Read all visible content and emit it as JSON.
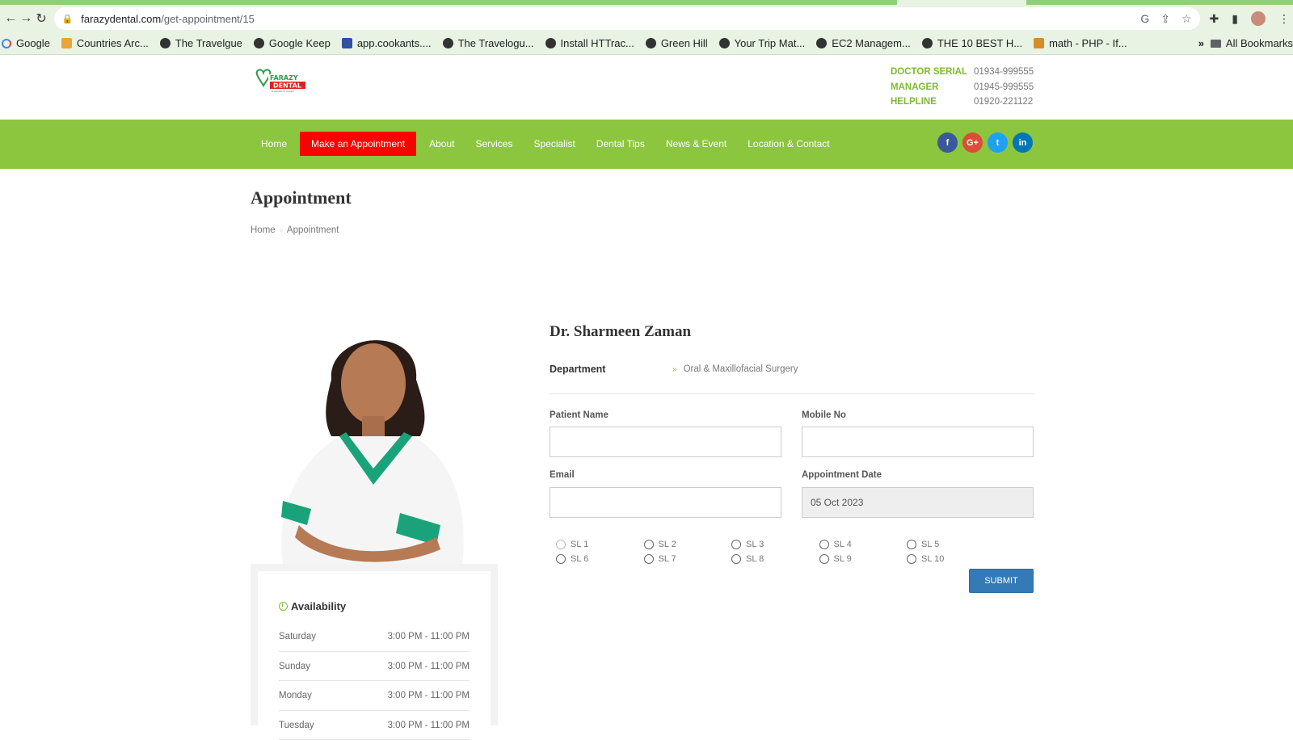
{
  "browser": {
    "url_domain": "farazydental.com",
    "url_path": "/get-appointment/15",
    "bookmarks": [
      {
        "label": "Google",
        "icon": "google-icon"
      },
      {
        "label": "Countries Arc...",
        "icon": "page-icon"
      },
      {
        "label": "The Travelgue",
        "icon": "globe-icon"
      },
      {
        "label": "Google Keep",
        "icon": "globe-icon"
      },
      {
        "label": "app.cookants....",
        "icon": "cookants-icon"
      },
      {
        "label": "The Travelogu...",
        "icon": "globe-icon"
      },
      {
        "label": "Install HTTrac...",
        "icon": "globe-icon"
      },
      {
        "label": "Green Hill",
        "icon": "globe-icon"
      },
      {
        "label": "Your Trip Mat...",
        "icon": "globe-icon"
      },
      {
        "label": "EC2 Managem...",
        "icon": "globe-icon"
      },
      {
        "label": "THE 10 BEST H...",
        "icon": "globe-icon"
      },
      {
        "label": "math - PHP - If...",
        "icon": "stackoverflow-icon"
      }
    ],
    "more": "»",
    "all_bookmarks": "All Bookmarks"
  },
  "header": {
    "contacts": [
      {
        "label": "DOCTOR SERIAL",
        "value": "01934-999555"
      },
      {
        "label": "MANAGER",
        "value": "01945-999555"
      },
      {
        "label": "HELPLINE",
        "value": "01920-221122"
      }
    ]
  },
  "nav": {
    "items": [
      "Home",
      "Make an Appointment",
      "About",
      "Services",
      "Specialist",
      "Dental Tips",
      "News & Event",
      "Location & Contact"
    ],
    "active_index": 1,
    "social": [
      "f",
      "G+",
      "t",
      "in"
    ]
  },
  "page": {
    "title": "Appointment",
    "breadcrumb": [
      "Home",
      "Appointment"
    ]
  },
  "doctor": {
    "name": "Dr. Sharmeen Zaman",
    "department_label": "Department",
    "department": "Oral & Maxillofacial Surgery"
  },
  "availability": {
    "title": "Availability",
    "rows": [
      {
        "day": "Saturday",
        "time": "3:00 PM - 11:00 PM"
      },
      {
        "day": "Sunday",
        "time": "3:00 PM - 11:00 PM"
      },
      {
        "day": "Monday",
        "time": "3:00 PM - 11:00 PM"
      },
      {
        "day": "Tuesday",
        "time": "3:00 PM - 11:00 PM"
      }
    ]
  },
  "form": {
    "patient_name_label": "Patient Name",
    "patient_name_value": "",
    "mobile_label": "Mobile No",
    "mobile_value": "",
    "email_label": "Email",
    "email_value": "",
    "date_label": "Appointment Date",
    "date_value": "05 Oct 2023",
    "slots": [
      "SL 1",
      "SL 2",
      "SL 3",
      "SL 4",
      "SL 5",
      "SL 6",
      "SL 7",
      "SL 8",
      "SL 9",
      "SL 10"
    ],
    "submit_label": "SUBMIT"
  },
  "colors": {
    "brand_green": "#8cc63f",
    "active_red": "#ff0000",
    "submit_blue": "#337ab7"
  }
}
